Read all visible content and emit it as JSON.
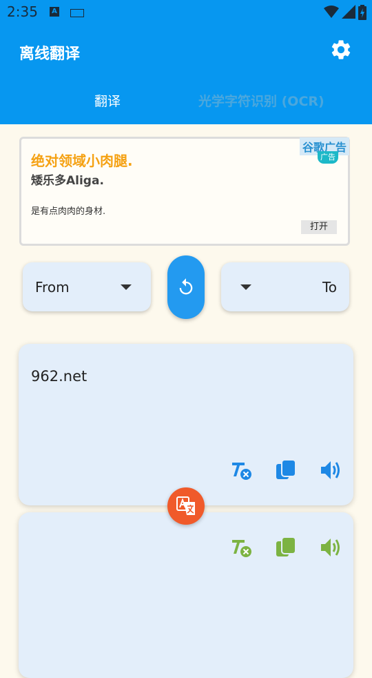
{
  "status_bar": {
    "time": "2:35",
    "input_badge": "A"
  },
  "app_bar": {
    "title": "离线翻译"
  },
  "tabs": [
    {
      "label": "翻译"
    },
    {
      "label": "光学字符识别 (OCR)"
    }
  ],
  "ad": {
    "tag": "谷歌广告",
    "badge": "广告",
    "title": "绝对领域小肉腿.",
    "subtitle": "矮乐多Aliga.",
    "description": "是有点肉肉的身材.",
    "button": "打开"
  },
  "language": {
    "from": "From",
    "to": "To"
  },
  "input_card": {
    "text": "962.net"
  },
  "colors": {
    "primary": "#0797f0",
    "input_icons": "#1e88e5",
    "output_icons": "#7cb342",
    "fab": "#f05a2a",
    "ad_title": "#f5a112"
  }
}
